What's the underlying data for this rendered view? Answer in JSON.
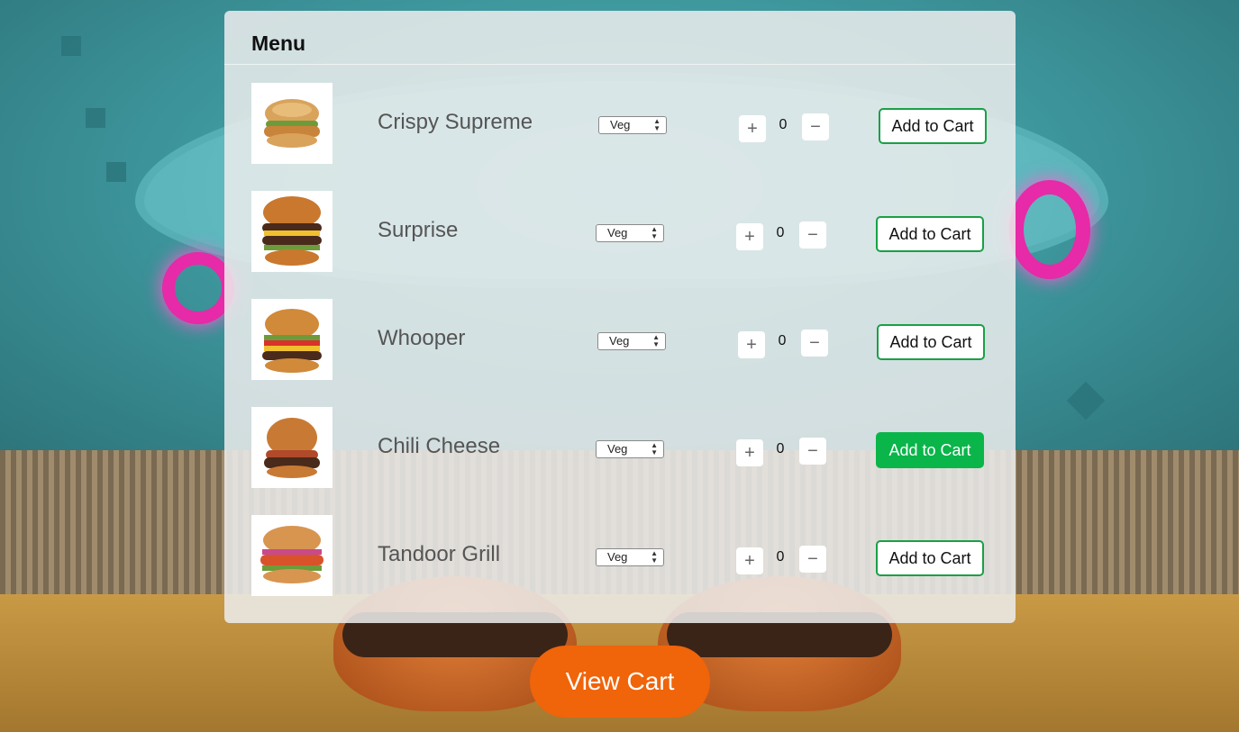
{
  "menu": {
    "title": "Menu",
    "items": [
      {
        "name": "Crispy Supreme",
        "variant": "Veg",
        "quantity": "0",
        "plus": "+",
        "minus": "−",
        "add_label": "Add to Cart",
        "add_active": false
      },
      {
        "name": "Surprise",
        "variant": "Veg",
        "quantity": "0",
        "plus": "+",
        "minus": "−",
        "add_label": "Add to Cart",
        "add_active": false
      },
      {
        "name": "Whooper",
        "variant": "Veg",
        "quantity": "0",
        "plus": "+",
        "minus": "−",
        "add_label": "Add to Cart",
        "add_active": false
      },
      {
        "name": "Chili Cheese",
        "variant": "Veg",
        "quantity": "0",
        "plus": "+",
        "minus": "−",
        "add_label": "Add to Cart",
        "add_active": true
      },
      {
        "name": "Tandoor Grill",
        "variant": "Veg",
        "quantity": "0",
        "plus": "+",
        "minus": "−",
        "add_label": "Add to Cart",
        "add_active": false
      }
    ]
  },
  "cart": {
    "view_label": "View Cart"
  },
  "colors": {
    "accent_green": "#19a046",
    "active_green": "#0ab54a",
    "cart_orange": "#f0640a"
  }
}
